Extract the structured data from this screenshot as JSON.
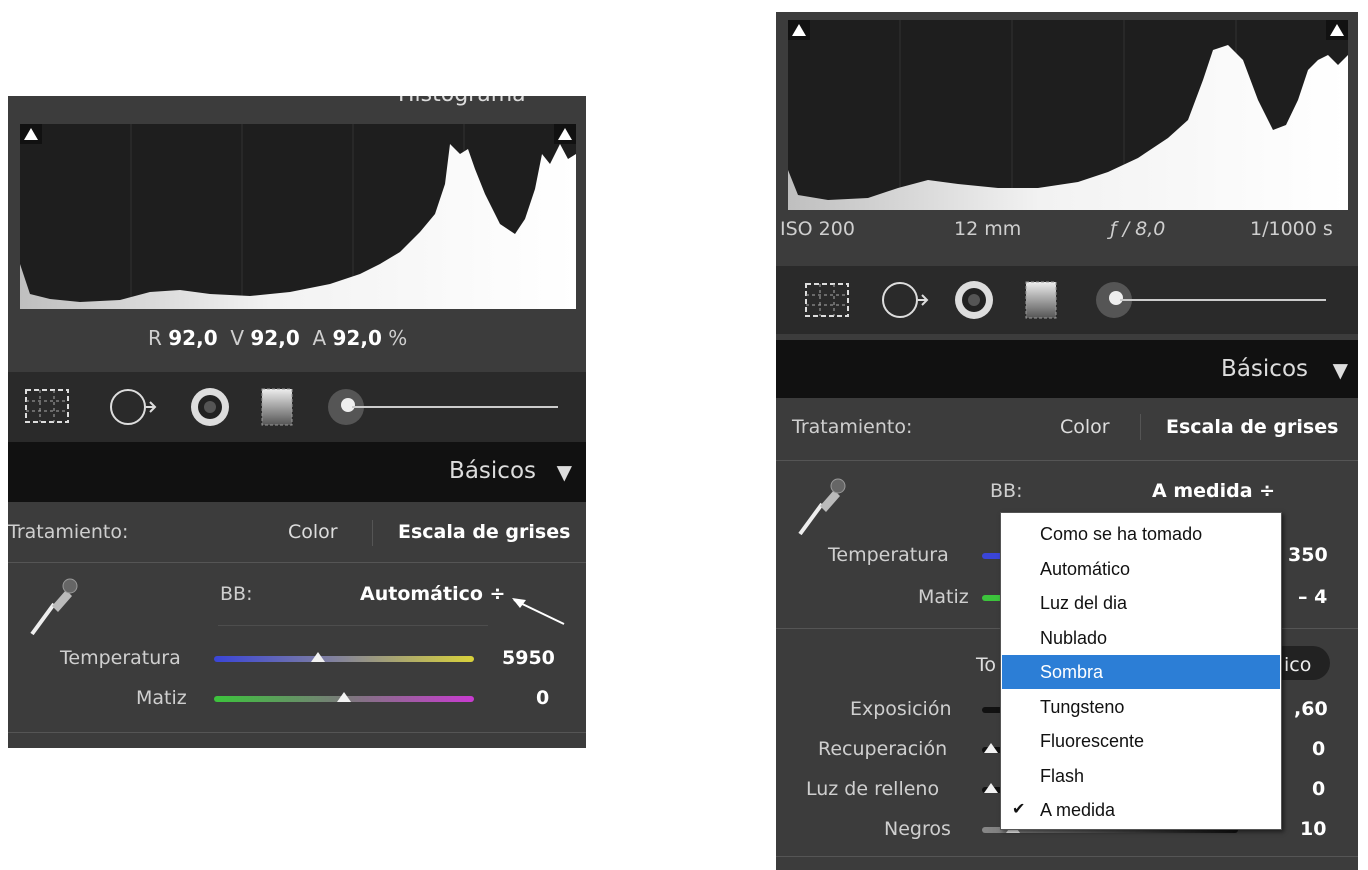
{
  "left": {
    "header_partial": "Histograma",
    "readout": {
      "r_label": "R",
      "r_value": "92,0",
      "v_label": "V",
      "v_value": "92,0",
      "a_label": "A",
      "a_value": "92,0",
      "unit": "%"
    },
    "section_title": "Básicos",
    "treatment_label": "Tratamiento:",
    "treatment_color": "Color",
    "treatment_gray": "Escala de grises",
    "wb_label": "BB:",
    "wb_value": "Automático ÷",
    "temp_label": "Temperatura",
    "temp_value": "5950",
    "temp_level": 0.4,
    "tint_label": "Matiz",
    "tint_value": "0",
    "tint_level": 0.5
  },
  "right": {
    "exif": {
      "iso": "ISO 200",
      "focal": "12 mm",
      "aperture": "ƒ / 8,0",
      "shutter": "1/1000 s"
    },
    "section_title": "Básicos",
    "treatment_label": "Tratamiento:",
    "treatment_color": "Color",
    "treatment_gray": "Escala de grises",
    "wb_label": "BB:",
    "wb_value": "A medida ÷",
    "temp_label": "Temperatura",
    "temp_value_partial": "350",
    "tint_label": "Matiz",
    "tint_value_partial": "– 4",
    "tone_partial_left": "To",
    "tone_partial_right": "ico",
    "exposure_label": "Exposición",
    "exposure_value_partial": ",60",
    "recovery_label": "Recuperación",
    "recovery_value": "0",
    "fill_label": "Luz de relleno",
    "fill_value": "0",
    "blacks_label": "Negros",
    "blacks_value": "10",
    "menu": {
      "items": [
        "Como se ha tomado",
        "Automático",
        "Luz del dia",
        "Nublado",
        "Sombra",
        "Tungsteno",
        "Fluorescente",
        "Flash",
        "A medida"
      ],
      "highlighted_index": 4,
      "checked_index": 8,
      "check_mark": "✔"
    }
  },
  "colors": {
    "panel": "#3c3c3c",
    "highlight": "#2c7ed6",
    "temp_left": "#3a45d8",
    "temp_right": "#d9d23a",
    "tint_left": "#3cc43c",
    "tint_right": "#c93bd1"
  }
}
